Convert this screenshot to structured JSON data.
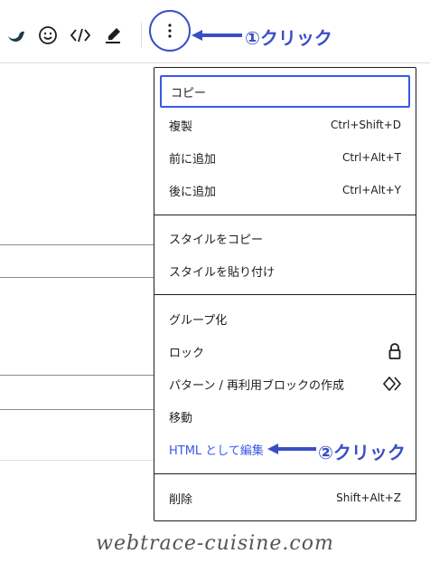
{
  "toolbar": {
    "icons": [
      "wave-icon",
      "smiley-icon",
      "code-icon",
      "highlighter-icon",
      "more-vertical-icon"
    ],
    "kebab_glyph": "⋮"
  },
  "annotations": {
    "step1": "①クリック",
    "step2": "②クリック",
    "color": "#3b4fc4"
  },
  "menu": {
    "groups": [
      {
        "items": [
          {
            "label": "コピー",
            "shortcut": "",
            "focused": true
          },
          {
            "label": "複製",
            "shortcut": "Ctrl+Shift+D"
          },
          {
            "label": "前に追加",
            "shortcut": "Ctrl+Alt+T"
          },
          {
            "label": "後に追加",
            "shortcut": "Ctrl+Alt+Y"
          }
        ]
      },
      {
        "items": [
          {
            "label": "スタイルをコピー",
            "shortcut": ""
          },
          {
            "label": "スタイルを貼り付け",
            "shortcut": ""
          }
        ]
      },
      {
        "items": [
          {
            "label": "グループ化",
            "shortcut": ""
          },
          {
            "label": "ロック",
            "icon": "lock-icon"
          },
          {
            "label": "パターン / 再利用ブロックの作成",
            "icon": "pattern-icon"
          },
          {
            "label": "移動",
            "shortcut": ""
          },
          {
            "label": "HTML として編集",
            "shortcut": "",
            "accent": true
          }
        ]
      },
      {
        "items": [
          {
            "label": "削除",
            "shortcut": "Shift+Alt+Z"
          }
        ]
      }
    ],
    "accent_color": "#3858e9"
  },
  "watermark": "webtrace-cuisine.com"
}
